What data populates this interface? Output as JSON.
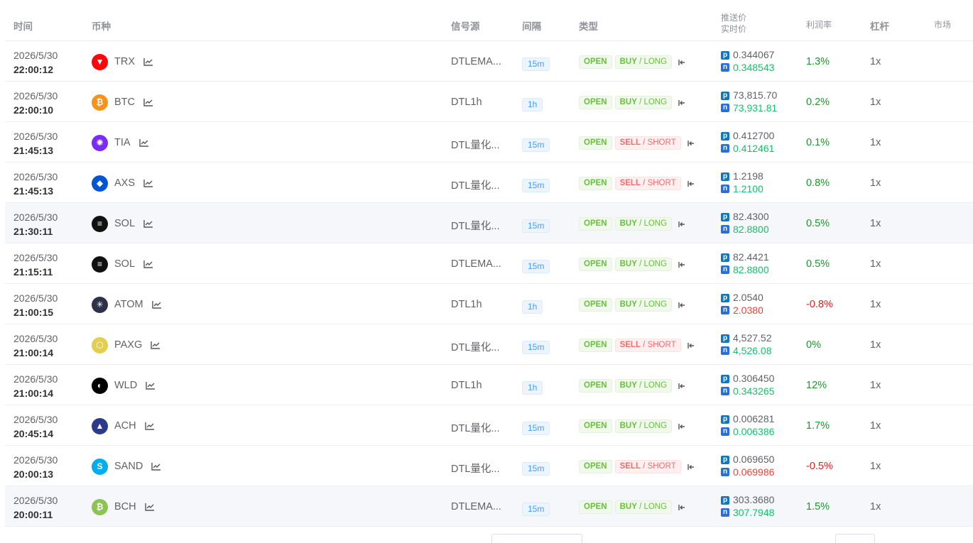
{
  "headers": {
    "time": "时间",
    "coin": "币种",
    "source": "信号源",
    "interval": "间隔",
    "type": "类型",
    "push_price": "推送价",
    "real_price": "实时价",
    "profit": "利润率",
    "leverage": "杠杆",
    "market": "市场"
  },
  "rows": [
    {
      "date": "2026/5/30",
      "time": "22:00:12",
      "symbol": "TRX",
      "icon": "trx-icon",
      "icon_color": "#ff060a",
      "source": "DTLEMA...",
      "interval": "15m",
      "status": "OPEN",
      "side": "BUY",
      "side2": "LONG",
      "dir": "buy",
      "push": "0.344067",
      "real": "0.348543",
      "real_trend": "up",
      "profit": "1.3%",
      "profit_trend": "up",
      "leverage": "1x"
    },
    {
      "date": "2026/5/30",
      "time": "22:00:10",
      "symbol": "BTC",
      "icon": "btc-icon",
      "icon_color": "#f7931a",
      "source": "DTL1h",
      "interval": "1h",
      "status": "OPEN",
      "side": "BUY",
      "side2": "LONG",
      "dir": "buy",
      "push": "73,815.70",
      "real": "73,931.81",
      "real_trend": "up",
      "profit": "0.2%",
      "profit_trend": "up",
      "leverage": "1x"
    },
    {
      "date": "2026/5/30",
      "time": "21:45:13",
      "symbol": "TIA",
      "icon": "tia-icon",
      "icon_color": "#7b2bf9",
      "source": "DTL量化...",
      "interval": "15m",
      "status": "OPEN",
      "side": "SELL",
      "side2": "SHORT",
      "dir": "sell",
      "push": "0.412700",
      "real": "0.412461",
      "real_trend": "up",
      "profit": "0.1%",
      "profit_trend": "up",
      "leverage": "1x"
    },
    {
      "date": "2026/5/30",
      "time": "21:45:13",
      "symbol": "AXS",
      "icon": "axs-icon",
      "icon_color": "#0055d5",
      "source": "DTL量化...",
      "interval": "15m",
      "status": "OPEN",
      "side": "SELL",
      "side2": "SHORT",
      "dir": "sell",
      "push": "1.2198",
      "real": "1.2100",
      "real_trend": "up",
      "profit": "0.8%",
      "profit_trend": "up",
      "leverage": "1x"
    },
    {
      "date": "2026/5/30",
      "time": "21:30:11",
      "symbol": "SOL",
      "icon": "sol-icon",
      "icon_color": "#111111",
      "source": "DTL量化...",
      "interval": "15m",
      "status": "OPEN",
      "side": "BUY",
      "side2": "LONG",
      "dir": "buy",
      "push": "82.4300",
      "real": "82.8800",
      "real_trend": "up",
      "profit": "0.5%",
      "profit_trend": "up",
      "leverage": "1x"
    },
    {
      "date": "2026/5/30",
      "time": "21:15:11",
      "symbol": "SOL",
      "icon": "sol-icon",
      "icon_color": "#111111",
      "source": "DTLEMA...",
      "interval": "15m",
      "status": "OPEN",
      "side": "BUY",
      "side2": "LONG",
      "dir": "buy",
      "push": "82.4421",
      "real": "82.8800",
      "real_trend": "up",
      "profit": "0.5%",
      "profit_trend": "up",
      "leverage": "1x"
    },
    {
      "date": "2026/5/30",
      "time": "21:00:15",
      "symbol": "ATOM",
      "icon": "atom-icon",
      "icon_color": "#2e3148",
      "source": "DTL1h",
      "interval": "1h",
      "status": "OPEN",
      "side": "BUY",
      "side2": "LONG",
      "dir": "buy",
      "push": "2.0540",
      "real": "2.0380",
      "real_trend": "down",
      "profit": "-0.8%",
      "profit_trend": "down",
      "leverage": "1x"
    },
    {
      "date": "2026/5/30",
      "time": "21:00:14",
      "symbol": "PAXG",
      "icon": "paxg-icon",
      "icon_color": "#e4ce4d",
      "source": "DTL量化...",
      "interval": "15m",
      "status": "OPEN",
      "side": "SELL",
      "side2": "SHORT",
      "dir": "sell",
      "push": "4,527.52",
      "real": "4,526.08",
      "real_trend": "up",
      "profit": "0%",
      "profit_trend": "up",
      "leverage": "1x"
    },
    {
      "date": "2026/5/30",
      "time": "21:00:14",
      "symbol": "WLD",
      "icon": "wld-icon",
      "icon_color": "#000000",
      "source": "DTL1h",
      "interval": "1h",
      "status": "OPEN",
      "side": "BUY",
      "side2": "LONG",
      "dir": "buy",
      "push": "0.306450",
      "real": "0.343265",
      "real_trend": "up",
      "profit": "12%",
      "profit_trend": "up",
      "leverage": "1x"
    },
    {
      "date": "2026/5/30",
      "time": "20:45:14",
      "symbol": "ACH",
      "icon": "ach-icon",
      "icon_color": "#2d3a8c",
      "source": "DTL量化...",
      "interval": "15m",
      "status": "OPEN",
      "side": "BUY",
      "side2": "LONG",
      "dir": "buy",
      "push": "0.006281",
      "real": "0.006386",
      "real_trend": "up",
      "profit": "1.7%",
      "profit_trend": "up",
      "leverage": "1x"
    },
    {
      "date": "2026/5/30",
      "time": "20:00:13",
      "symbol": "SAND",
      "icon": "sand-icon",
      "icon_color": "#00adef",
      "source": "DTL量化...",
      "interval": "15m",
      "status": "OPEN",
      "side": "SELL",
      "side2": "SHORT",
      "dir": "sell",
      "push": "0.069650",
      "real": "0.069986",
      "real_trend": "down",
      "profit": "-0.5%",
      "profit_trend": "down",
      "leverage": "1x"
    },
    {
      "date": "2026/5/30",
      "time": "20:00:11",
      "symbol": "BCH",
      "icon": "bch-icon",
      "icon_color": "#8dc351",
      "source": "DTLEMA...",
      "interval": "15m",
      "status": "OPEN",
      "side": "BUY",
      "side2": "LONG",
      "dir": "buy",
      "push": "303.3680",
      "real": "307.7948",
      "real_trend": "up",
      "profit": "1.5%",
      "profit_trend": "up",
      "leverage": "1x"
    }
  ],
  "highlighted_rows": [
    4,
    11
  ]
}
